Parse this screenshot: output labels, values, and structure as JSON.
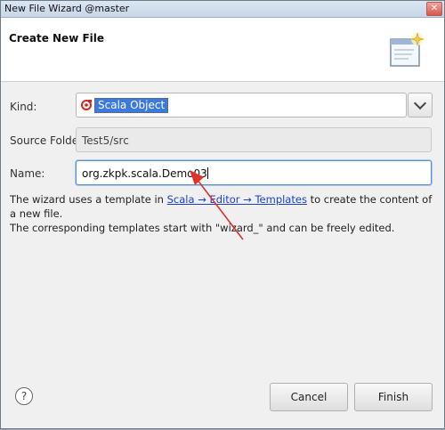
{
  "window": {
    "title": "New File Wizard @master"
  },
  "header": {
    "title": "Create New File",
    "icon": "wizard-page-icon"
  },
  "form": {
    "kind_label": "Kind:",
    "kind_value": "Scala Object",
    "kind_icon": "scala-object-icon",
    "source_folder_label": "Source Folder:",
    "source_folder_value": "Test5/src",
    "name_label": "Name:",
    "name_value": "org.zkpk.scala.Demo03"
  },
  "description": {
    "line1_prefix": "The wizard uses a template in ",
    "link_text": "Scala → Editor → Templates",
    "line1_suffix": " to create the content of a new file.",
    "line2": "The corresponding templates start with \"wizard_\" and can be freely edited."
  },
  "footer": {
    "help_symbol": "?",
    "cancel_label": "Cancel",
    "finish_label": "Finish"
  },
  "colors": {
    "selection": "#3b7ae0",
    "annotation_arrow": "#e0322b",
    "link": "#1a3fd1"
  }
}
